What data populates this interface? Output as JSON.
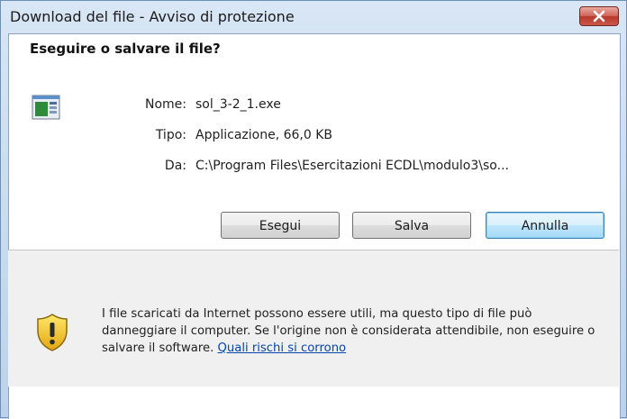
{
  "window": {
    "title": "Download del file - Avviso di protezione",
    "close_icon": "close-icon"
  },
  "dialog": {
    "heading": "Eseguire o salvare il file?",
    "file_icon": "application-icon",
    "fields": {
      "name_label": "Nome:",
      "name_value": "sol_3-2_1.exe",
      "type_label": "Tipo:",
      "type_value": "Applicazione, 66,0 KB",
      "from_label": "Da:",
      "from_value": "C:\\Program Files\\Esercitazioni ECDL\\modulo3\\so..."
    },
    "buttons": {
      "run": "Esegui",
      "save": "Salva",
      "cancel": "Annulla"
    }
  },
  "warning": {
    "icon": "security-shield-icon",
    "text": "I file scaricati da Internet possono essere utili, ma questo tipo di file può danneggiare il computer. Se l'origine non è considerata attendibile, non eseguire o salvare il software.",
    "link": "Quali rischi si corrono"
  },
  "colors": {
    "title_bar": "#c9dbef",
    "close_button": "#c9584a",
    "link": "#0645ad",
    "lower_panel": "#f0f0f0"
  }
}
